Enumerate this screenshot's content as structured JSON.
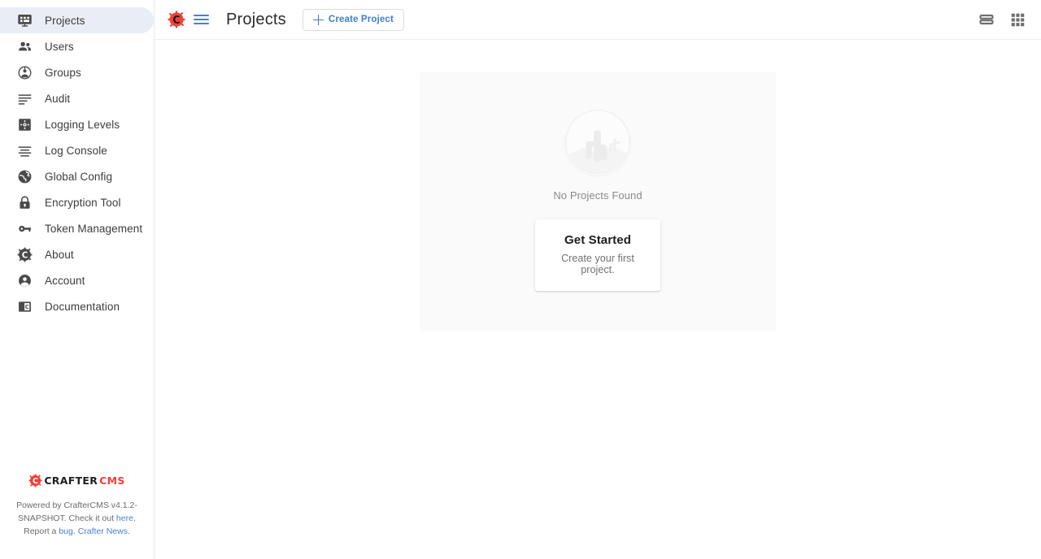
{
  "sidebar": {
    "items": [
      {
        "label": "Projects",
        "icon": "projects-icon",
        "active": true
      },
      {
        "label": "Users",
        "icon": "users-icon",
        "active": false
      },
      {
        "label": "Groups",
        "icon": "groups-icon",
        "active": false
      },
      {
        "label": "Audit",
        "icon": "audit-icon",
        "active": false
      },
      {
        "label": "Logging Levels",
        "icon": "logging-levels-icon",
        "active": false
      },
      {
        "label": "Log Console",
        "icon": "log-console-icon",
        "active": false
      },
      {
        "label": "Global Config",
        "icon": "globe-icon",
        "active": false
      },
      {
        "label": "Encryption Tool",
        "icon": "lock-icon",
        "active": false
      },
      {
        "label": "Token Management",
        "icon": "key-icon",
        "active": false
      },
      {
        "label": "About",
        "icon": "gear-c-icon",
        "active": false
      },
      {
        "label": "Account",
        "icon": "account-icon",
        "active": false
      },
      {
        "label": "Documentation",
        "icon": "book-icon",
        "active": false
      }
    ],
    "footer": {
      "brand_primary": "CRAFTER",
      "brand_secondary": "CMS",
      "text_part1": "Powered by CrafterCMS v4.1.2-SNAPSHOT. Check it out ",
      "link_here": "here",
      "text_part2": ". Report a ",
      "link_bug": "bug",
      "text_part3": ". ",
      "link_news": "Crafter News",
      "text_part4": "."
    }
  },
  "topbar": {
    "logo": "crafter-gear-logo",
    "menu_icon": "hamburger-menu-icon",
    "title": "Projects",
    "create_label": "Create Project",
    "view_toggle_icon": "list-view-icon",
    "apps_icon": "apps-grid-icon"
  },
  "content": {
    "illustration": "empty-desert-cactus-illustration",
    "empty_title": "No Projects Found",
    "card": {
      "title": "Get Started",
      "subtitle": "Create your first project."
    }
  },
  "colors": {
    "accent_blue": "#3f7bd8",
    "brand_red": "#ef4136",
    "active_nav_bg": "#e9eef6",
    "panel_bg": "#fafafa",
    "text_primary": "#3c3c3c",
    "text_muted": "#8a8a8a"
  }
}
